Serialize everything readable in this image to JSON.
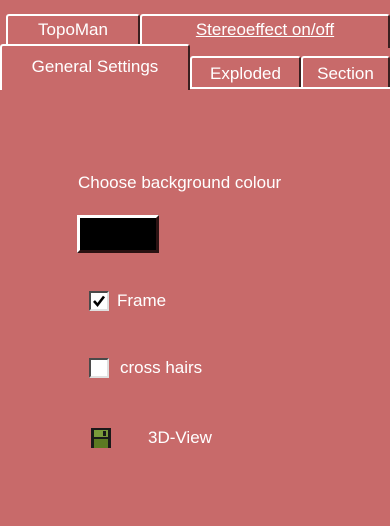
{
  "tabs_back_row": [
    {
      "label": "TopoMan",
      "underlined": false
    },
    {
      "label": "Stereoeffect on/off",
      "underlined": true
    }
  ],
  "tabs_front_row": [
    {
      "label": "General Settings",
      "active": true
    },
    {
      "label": "Exploded",
      "active": false
    },
    {
      "label": "Section",
      "active": false
    }
  ],
  "general_settings": {
    "background_colour_label": "Choose background colour",
    "background_colour": "#000000",
    "frame": {
      "label": "Frame",
      "checked": true
    },
    "cross_hairs": {
      "label": "cross hairs",
      "checked": false
    },
    "view_3d": {
      "label": "3D-View",
      "icon": "floppy-disk-icon"
    }
  },
  "colors": {
    "panel_background": "#c86a6a",
    "text": "#ffffff"
  }
}
